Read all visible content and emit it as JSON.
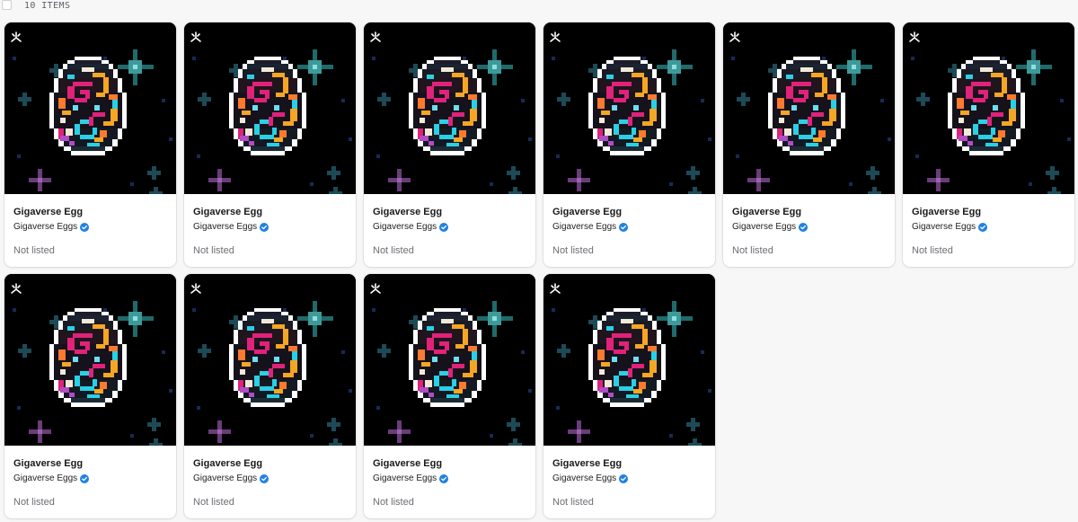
{
  "header": {
    "item_count": "10 ITEMS"
  },
  "colors": {
    "page_background": "#f7f7f8",
    "card_background": "#ffffff",
    "art_background": "#000000",
    "verified_badge": "#2081e2"
  },
  "items": [
    {
      "name": "Gigaverse Egg",
      "collection": "Gigaverse Eggs",
      "status": "Not listed",
      "chain_icon": "chain-icon",
      "verified": true
    },
    {
      "name": "Gigaverse Egg",
      "collection": "Gigaverse Eggs",
      "status": "Not listed",
      "chain_icon": "chain-icon",
      "verified": true
    },
    {
      "name": "Gigaverse Egg",
      "collection": "Gigaverse Eggs",
      "status": "Not listed",
      "chain_icon": "chain-icon",
      "verified": true
    },
    {
      "name": "Gigaverse Egg",
      "collection": "Gigaverse Eggs",
      "status": "Not listed",
      "chain_icon": "chain-icon",
      "verified": true
    },
    {
      "name": "Gigaverse Egg",
      "collection": "Gigaverse Eggs",
      "status": "Not listed",
      "chain_icon": "chain-icon",
      "verified": true
    },
    {
      "name": "Gigaverse Egg",
      "collection": "Gigaverse Eggs",
      "status": "Not listed",
      "chain_icon": "chain-icon",
      "verified": true
    },
    {
      "name": "Gigaverse Egg",
      "collection": "Gigaverse Eggs",
      "status": "Not listed",
      "chain_icon": "chain-icon",
      "verified": true
    },
    {
      "name": "Gigaverse Egg",
      "collection": "Gigaverse Eggs",
      "status": "Not listed",
      "chain_icon": "chain-icon",
      "verified": true
    },
    {
      "name": "Gigaverse Egg",
      "collection": "Gigaverse Eggs",
      "status": "Not listed",
      "chain_icon": "chain-icon",
      "verified": true
    },
    {
      "name": "Gigaverse Egg",
      "collection": "Gigaverse Eggs",
      "status": "Not listed",
      "chain_icon": "chain-icon",
      "verified": true
    }
  ]
}
